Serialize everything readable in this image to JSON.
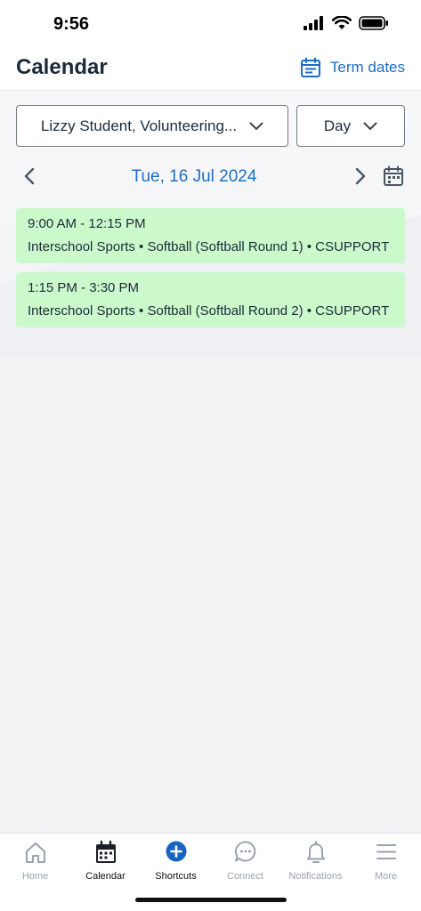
{
  "status_bar": {
    "time": "9:56"
  },
  "header": {
    "title": "Calendar",
    "term_dates_label": "Term dates"
  },
  "filters": {
    "student_selected": "Lizzy Student, Volunteering...",
    "view_selected": "Day"
  },
  "date_nav": {
    "date_label": "Tue, 16 Jul 2024"
  },
  "events": [
    {
      "time": "9:00 AM - 12:15 PM",
      "description": "Interschool Sports • Softball (Softball Round 1) • CSUPPORT"
    },
    {
      "time": "1:15 PM - 3:30 PM",
      "description": "Interschool Sports • Softball (Softball Round 2) • CSUPPORT"
    }
  ],
  "tabs": [
    {
      "label": "Home",
      "icon": "home-icon",
      "active": false
    },
    {
      "label": "Calendar",
      "icon": "calendar-icon",
      "active": true
    },
    {
      "label": "Shortcuts",
      "icon": "plus-circle-icon",
      "active": true
    },
    {
      "label": "Connect",
      "icon": "chat-bubble-icon",
      "active": false
    },
    {
      "label": "Notifications",
      "icon": "bell-icon",
      "active": false
    },
    {
      "label": "More",
      "icon": "menu-icon",
      "active": false
    }
  ],
  "colors": {
    "accent": "#1a6fc4",
    "event_bg": "#ccf9cc",
    "title": "#1c2b3a",
    "tab_inactive": "#9aa3ad"
  }
}
